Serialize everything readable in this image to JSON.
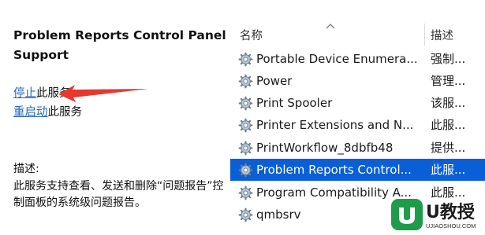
{
  "details": {
    "service_title": "Problem Reports Control Panel Support",
    "stop_link": "停止",
    "stop_rest": "此服务",
    "restart_link": "重启动",
    "restart_rest": "此服务",
    "description_label": "描述:",
    "description_text": "此服务支持查看、发送和删除“问题报告”控制面板的系统级问题报告。"
  },
  "list": {
    "columns": {
      "name": "名称",
      "description": "描述"
    },
    "sort_column": "name",
    "rows": [
      {
        "name": "Portable Device Enumera...",
        "desc": "强制...",
        "icon": "gear-icon",
        "selected": false
      },
      {
        "name": "Power",
        "desc": "管理...",
        "icon": "gear-icon",
        "selected": false
      },
      {
        "name": "Print Spooler",
        "desc": "该服...",
        "icon": "gear-icon",
        "selected": false
      },
      {
        "name": "Printer Extensions and N...",
        "desc": "此服...",
        "icon": "gear-icon",
        "selected": false
      },
      {
        "name": "PrintWorkflow_8dbfb48",
        "desc": "提供...",
        "icon": "gear-icon",
        "selected": false
      },
      {
        "name": "Problem Reports Control...",
        "desc": "此服...",
        "icon": "gear-icon",
        "selected": true
      },
      {
        "name": "Program Compatibility A...",
        "desc": "此服...",
        "icon": "gear-icon",
        "selected": false
      },
      {
        "name": "qmbsrv",
        "desc": "",
        "icon": "gear-icon",
        "selected": false
      }
    ]
  },
  "annotation": {
    "arrow_color": "#e8372e",
    "points_to": "stop-link"
  },
  "watermark": {
    "brand": "U教授",
    "url": "UJIAOSHOU.COM",
    "logo_color": "#1f9c4a"
  },
  "colors": {
    "selection": "#0a5fd6",
    "link": "#1f63b8"
  }
}
